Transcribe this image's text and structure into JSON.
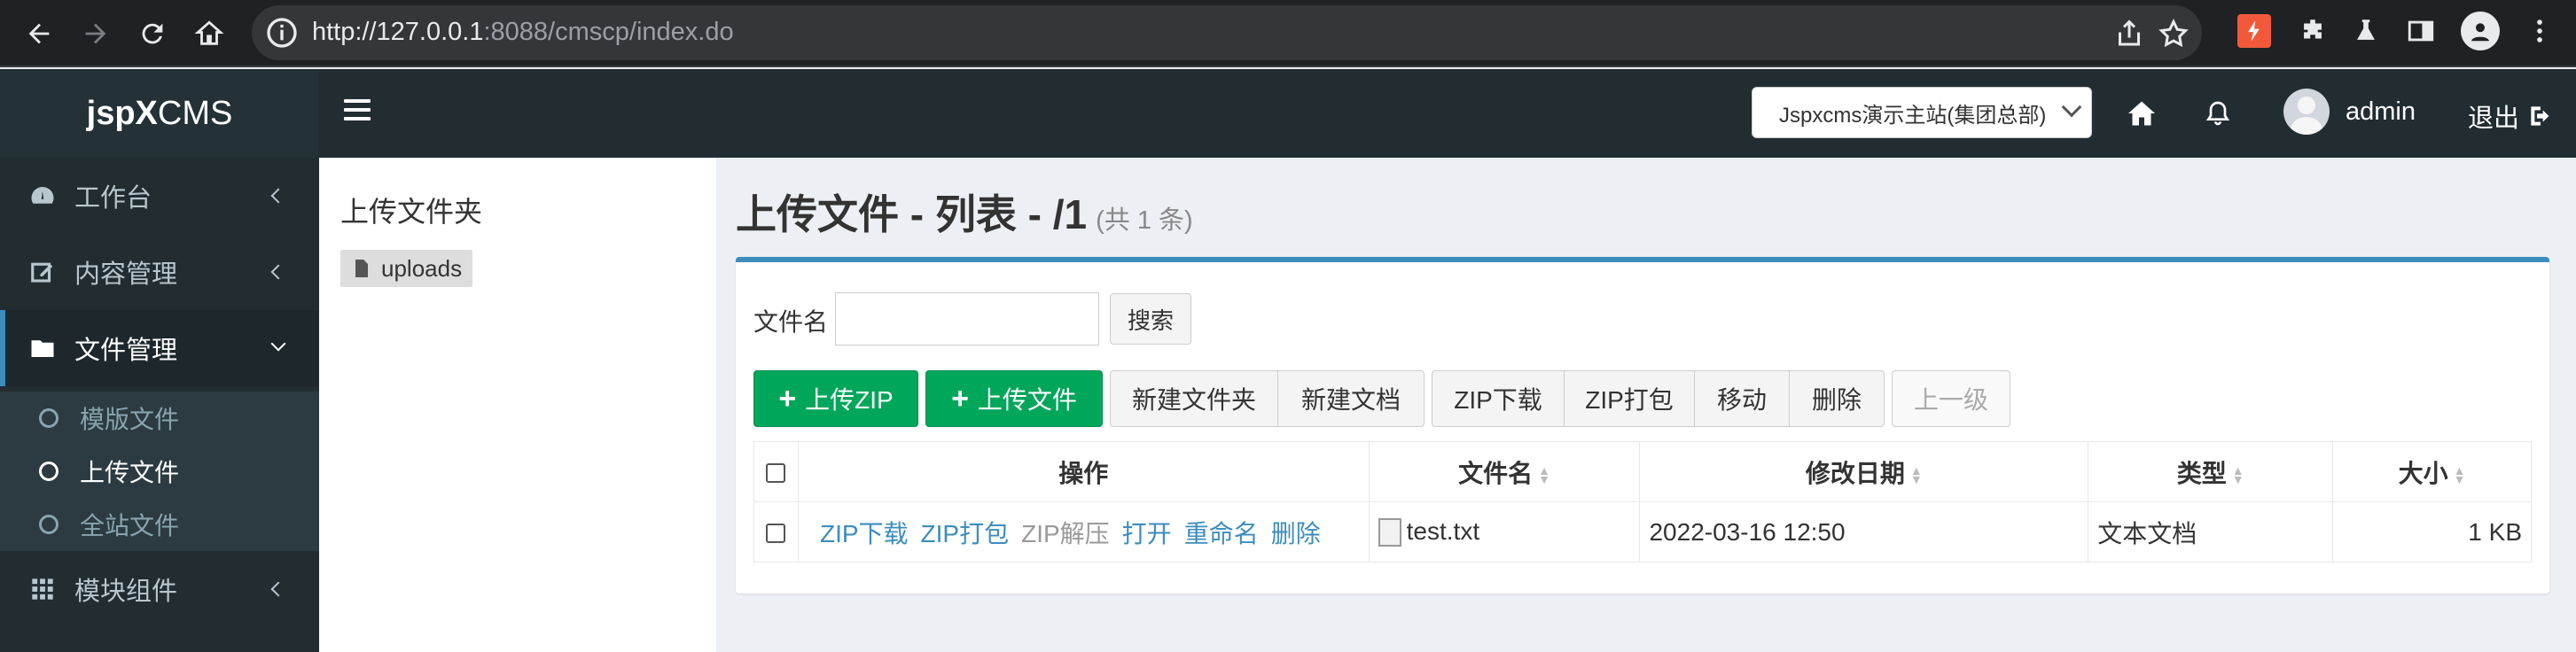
{
  "browser": {
    "url_host": "http://127.0.0.1",
    "url_rest": ":8088/cmscp/index.do"
  },
  "header": {
    "logo_bold": "jspX",
    "logo_light": "CMS",
    "site_select": "Jspxcms演示主站(集团总部)",
    "user": "admin",
    "logout": "退出"
  },
  "sidebar": {
    "items": [
      {
        "label": "工作台",
        "icon": "dashboard-icon"
      },
      {
        "label": "内容管理",
        "icon": "edit-icon"
      },
      {
        "label": "文件管理",
        "icon": "folder-icon"
      },
      {
        "label": "模块组件",
        "icon": "grid-icon"
      }
    ],
    "sub_items": [
      {
        "label": "模版文件"
      },
      {
        "label": "上传文件"
      },
      {
        "label": "全站文件"
      }
    ]
  },
  "folder_panel": {
    "title": "上传文件夹",
    "node": "uploads"
  },
  "main": {
    "title": "上传文件 - 列表 - /1",
    "count": "(共 1 条)",
    "search_label": "文件名",
    "search_value": "",
    "search_button": "搜索",
    "buttons": {
      "upload_zip": "上传ZIP",
      "upload_file": "上传文件",
      "new_folder": "新建文件夹",
      "new_doc": "新建文档",
      "zip_download": "ZIP下载",
      "zip_pack": "ZIP打包",
      "move": "移动",
      "delete": "删除",
      "up": "上一级"
    },
    "table": {
      "headers": {
        "op": "操作",
        "name": "文件名",
        "date": "修改日期",
        "type": "类型",
        "size": "大小"
      },
      "rows": [
        {
          "actions": [
            "ZIP下载",
            "ZIP打包",
            "ZIP解压",
            "打开",
            "重命名",
            "删除"
          ],
          "name": "test.txt",
          "date": "2022-03-16 12:50",
          "type": "文本文档",
          "size": "1 KB"
        }
      ]
    }
  },
  "colors": {
    "accent": "#3c8dbc",
    "green": "#00a65a",
    "sidebar": "#222d32"
  }
}
